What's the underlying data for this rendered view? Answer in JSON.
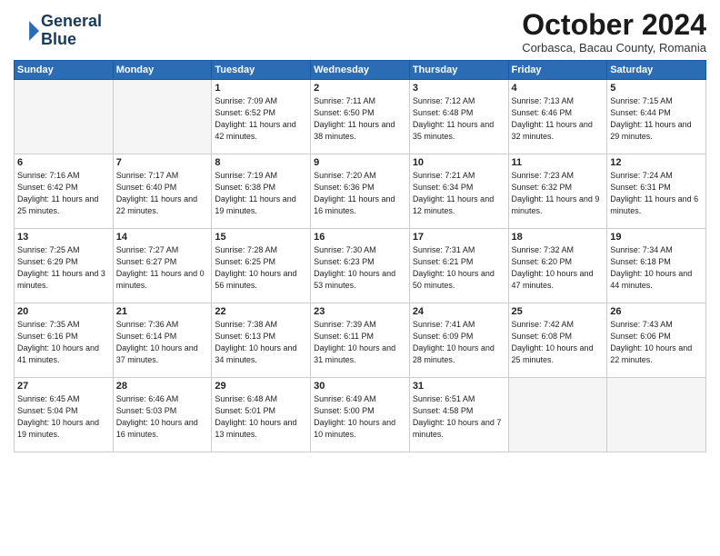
{
  "logo": {
    "line1": "General",
    "line2": "Blue"
  },
  "title": "October 2024",
  "location": "Corbasca, Bacau County, Romania",
  "headers": [
    "Sunday",
    "Monday",
    "Tuesday",
    "Wednesday",
    "Thursday",
    "Friday",
    "Saturday"
  ],
  "weeks": [
    [
      {
        "day": "",
        "sunrise": "",
        "sunset": "",
        "daylight": ""
      },
      {
        "day": "",
        "sunrise": "",
        "sunset": "",
        "daylight": ""
      },
      {
        "day": "1",
        "sunrise": "Sunrise: 7:09 AM",
        "sunset": "Sunset: 6:52 PM",
        "daylight": "Daylight: 11 hours and 42 minutes."
      },
      {
        "day": "2",
        "sunrise": "Sunrise: 7:11 AM",
        "sunset": "Sunset: 6:50 PM",
        "daylight": "Daylight: 11 hours and 38 minutes."
      },
      {
        "day": "3",
        "sunrise": "Sunrise: 7:12 AM",
        "sunset": "Sunset: 6:48 PM",
        "daylight": "Daylight: 11 hours and 35 minutes."
      },
      {
        "day": "4",
        "sunrise": "Sunrise: 7:13 AM",
        "sunset": "Sunset: 6:46 PM",
        "daylight": "Daylight: 11 hours and 32 minutes."
      },
      {
        "day": "5",
        "sunrise": "Sunrise: 7:15 AM",
        "sunset": "Sunset: 6:44 PM",
        "daylight": "Daylight: 11 hours and 29 minutes."
      }
    ],
    [
      {
        "day": "6",
        "sunrise": "Sunrise: 7:16 AM",
        "sunset": "Sunset: 6:42 PM",
        "daylight": "Daylight: 11 hours and 25 minutes."
      },
      {
        "day": "7",
        "sunrise": "Sunrise: 7:17 AM",
        "sunset": "Sunset: 6:40 PM",
        "daylight": "Daylight: 11 hours and 22 minutes."
      },
      {
        "day": "8",
        "sunrise": "Sunrise: 7:19 AM",
        "sunset": "Sunset: 6:38 PM",
        "daylight": "Daylight: 11 hours and 19 minutes."
      },
      {
        "day": "9",
        "sunrise": "Sunrise: 7:20 AM",
        "sunset": "Sunset: 6:36 PM",
        "daylight": "Daylight: 11 hours and 16 minutes."
      },
      {
        "day": "10",
        "sunrise": "Sunrise: 7:21 AM",
        "sunset": "Sunset: 6:34 PM",
        "daylight": "Daylight: 11 hours and 12 minutes."
      },
      {
        "day": "11",
        "sunrise": "Sunrise: 7:23 AM",
        "sunset": "Sunset: 6:32 PM",
        "daylight": "Daylight: 11 hours and 9 minutes."
      },
      {
        "day": "12",
        "sunrise": "Sunrise: 7:24 AM",
        "sunset": "Sunset: 6:31 PM",
        "daylight": "Daylight: 11 hours and 6 minutes."
      }
    ],
    [
      {
        "day": "13",
        "sunrise": "Sunrise: 7:25 AM",
        "sunset": "Sunset: 6:29 PM",
        "daylight": "Daylight: 11 hours and 3 minutes."
      },
      {
        "day": "14",
        "sunrise": "Sunrise: 7:27 AM",
        "sunset": "Sunset: 6:27 PM",
        "daylight": "Daylight: 11 hours and 0 minutes."
      },
      {
        "day": "15",
        "sunrise": "Sunrise: 7:28 AM",
        "sunset": "Sunset: 6:25 PM",
        "daylight": "Daylight: 10 hours and 56 minutes."
      },
      {
        "day": "16",
        "sunrise": "Sunrise: 7:30 AM",
        "sunset": "Sunset: 6:23 PM",
        "daylight": "Daylight: 10 hours and 53 minutes."
      },
      {
        "day": "17",
        "sunrise": "Sunrise: 7:31 AM",
        "sunset": "Sunset: 6:21 PM",
        "daylight": "Daylight: 10 hours and 50 minutes."
      },
      {
        "day": "18",
        "sunrise": "Sunrise: 7:32 AM",
        "sunset": "Sunset: 6:20 PM",
        "daylight": "Daylight: 10 hours and 47 minutes."
      },
      {
        "day": "19",
        "sunrise": "Sunrise: 7:34 AM",
        "sunset": "Sunset: 6:18 PM",
        "daylight": "Daylight: 10 hours and 44 minutes."
      }
    ],
    [
      {
        "day": "20",
        "sunrise": "Sunrise: 7:35 AM",
        "sunset": "Sunset: 6:16 PM",
        "daylight": "Daylight: 10 hours and 41 minutes."
      },
      {
        "day": "21",
        "sunrise": "Sunrise: 7:36 AM",
        "sunset": "Sunset: 6:14 PM",
        "daylight": "Daylight: 10 hours and 37 minutes."
      },
      {
        "day": "22",
        "sunrise": "Sunrise: 7:38 AM",
        "sunset": "Sunset: 6:13 PM",
        "daylight": "Daylight: 10 hours and 34 minutes."
      },
      {
        "day": "23",
        "sunrise": "Sunrise: 7:39 AM",
        "sunset": "Sunset: 6:11 PM",
        "daylight": "Daylight: 10 hours and 31 minutes."
      },
      {
        "day": "24",
        "sunrise": "Sunrise: 7:41 AM",
        "sunset": "Sunset: 6:09 PM",
        "daylight": "Daylight: 10 hours and 28 minutes."
      },
      {
        "day": "25",
        "sunrise": "Sunrise: 7:42 AM",
        "sunset": "Sunset: 6:08 PM",
        "daylight": "Daylight: 10 hours and 25 minutes."
      },
      {
        "day": "26",
        "sunrise": "Sunrise: 7:43 AM",
        "sunset": "Sunset: 6:06 PM",
        "daylight": "Daylight: 10 hours and 22 minutes."
      }
    ],
    [
      {
        "day": "27",
        "sunrise": "Sunrise: 6:45 AM",
        "sunset": "Sunset: 5:04 PM",
        "daylight": "Daylight: 10 hours and 19 minutes."
      },
      {
        "day": "28",
        "sunrise": "Sunrise: 6:46 AM",
        "sunset": "Sunset: 5:03 PM",
        "daylight": "Daylight: 10 hours and 16 minutes."
      },
      {
        "day": "29",
        "sunrise": "Sunrise: 6:48 AM",
        "sunset": "Sunset: 5:01 PM",
        "daylight": "Daylight: 10 hours and 13 minutes."
      },
      {
        "day": "30",
        "sunrise": "Sunrise: 6:49 AM",
        "sunset": "Sunset: 5:00 PM",
        "daylight": "Daylight: 10 hours and 10 minutes."
      },
      {
        "day": "31",
        "sunrise": "Sunrise: 6:51 AM",
        "sunset": "Sunset: 4:58 PM",
        "daylight": "Daylight: 10 hours and 7 minutes."
      },
      {
        "day": "",
        "sunrise": "",
        "sunset": "",
        "daylight": ""
      },
      {
        "day": "",
        "sunrise": "",
        "sunset": "",
        "daylight": ""
      }
    ]
  ]
}
